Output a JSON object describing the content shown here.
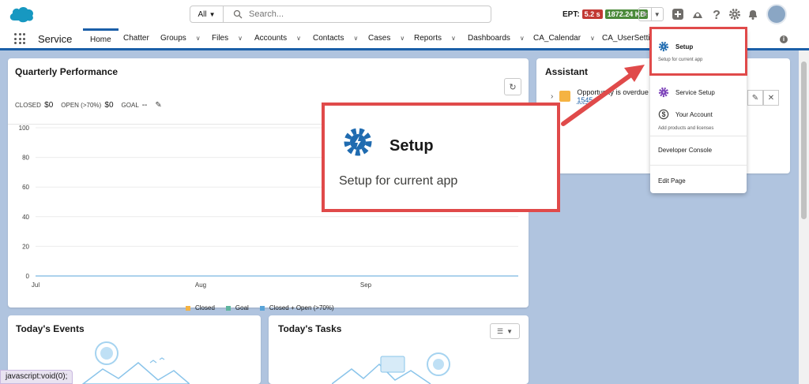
{
  "header": {
    "search": {
      "scope": "All",
      "placeholder": "Search..."
    },
    "ept_label": "EPT:",
    "ept_time": "5.2 s",
    "ept_size": "1872.24 KB"
  },
  "nav": {
    "app_name": "Service",
    "tabs": [
      {
        "label": "Home"
      },
      {
        "label": "Chatter"
      },
      {
        "label": "Groups"
      },
      {
        "label": "Files"
      },
      {
        "label": "Accounts"
      },
      {
        "label": "Contacts"
      },
      {
        "label": "Cases"
      },
      {
        "label": "Reports"
      },
      {
        "label": "Dashboards"
      },
      {
        "label": "CA_Calendar"
      },
      {
        "label": "CA_UserSetting"
      }
    ]
  },
  "performance": {
    "title": "Quarterly Performance",
    "closed_label": "CLOSED",
    "closed_value": "$0",
    "open_label": "OPEN (>70%)",
    "open_value": "$0",
    "goal_label": "GOAL",
    "goal_value": "--"
  },
  "chart_data": {
    "type": "line",
    "categories": [
      "Jul",
      "Aug",
      "Sep"
    ],
    "yticks": [
      0,
      20,
      40,
      60,
      80,
      100
    ],
    "ylim": [
      0,
      100
    ],
    "grid": true,
    "legend_position": "bottom",
    "series": [
      {
        "name": "Closed",
        "color": "#f5b342",
        "values": [
          0,
          0,
          0
        ]
      },
      {
        "name": "Goal",
        "color": "#5fb59e",
        "values": [
          0,
          0,
          0
        ]
      },
      {
        "name": "Closed + Open (>70%)",
        "color": "#5aa4d8",
        "values": [
          0,
          0,
          0
        ]
      }
    ]
  },
  "assistant": {
    "title": "Assistant",
    "item_text": "Opportunity is overdue",
    "item_link": "1545"
  },
  "events": {
    "title": "Today's Events"
  },
  "tasks": {
    "title": "Today's Tasks"
  },
  "setup_menu": {
    "setup_label": "Setup",
    "setup_sub": "Setup for current app",
    "service_setup": "Service Setup",
    "your_account": "Your Account",
    "your_account_sub": "Add products and licenses",
    "developer_console": "Developer Console",
    "edit_page": "Edit Page"
  },
  "callout": {
    "title": "Setup",
    "subtitle": "Setup for current app"
  },
  "status_bar": "javascript:void(0);",
  "colors": {
    "brand_blue": "#1b5fa8",
    "highlight_red": "#e04a4a",
    "setup_icon": "#1f6bb0",
    "service_icon": "#7a3fb8"
  }
}
